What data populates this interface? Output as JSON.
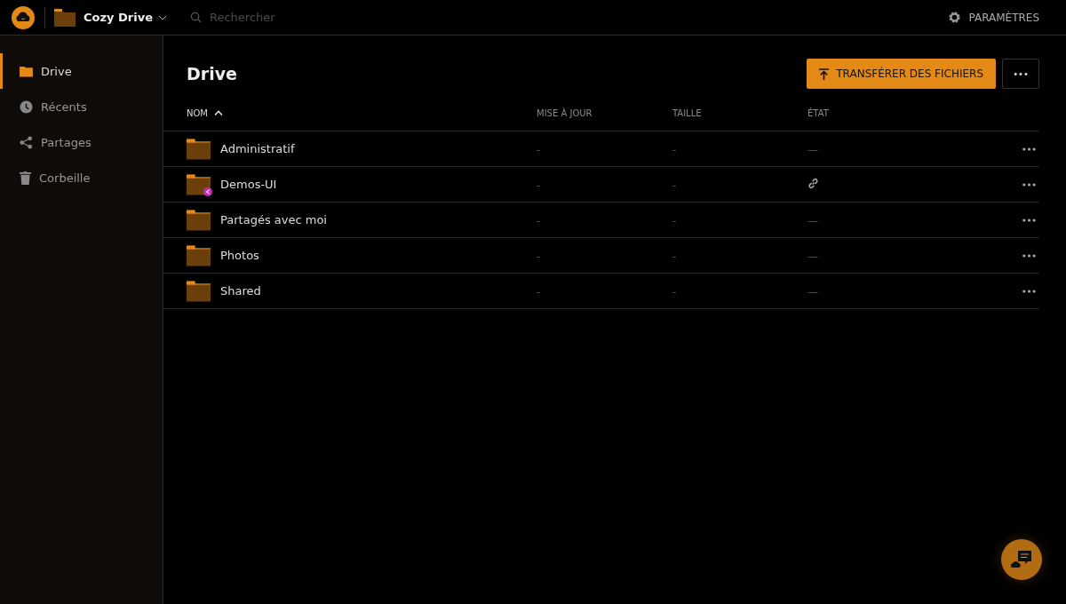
{
  "app": {
    "name": "Cozy Drive"
  },
  "search": {
    "placeholder": "Rechercher"
  },
  "settings": {
    "label": "PARAMÈTRES"
  },
  "sidebar": {
    "items": [
      {
        "label": "Drive",
        "selected": true
      },
      {
        "label": "Récents",
        "selected": false
      },
      {
        "label": "Partages",
        "selected": false
      },
      {
        "label": "Corbeille",
        "selected": false
      }
    ]
  },
  "page": {
    "title": "Drive",
    "upload_button": "TRANSFÉRER DES FICHIERS",
    "more_button": "•••"
  },
  "table": {
    "columns": [
      {
        "label": "NOM",
        "sorted": true
      },
      {
        "label": "MISE À JOUR",
        "sorted": false
      },
      {
        "label": "TAILLE",
        "sorted": false
      },
      {
        "label": "ÉTAT",
        "sorted": false
      }
    ],
    "rows": [
      {
        "name": "Administratif",
        "shared": false,
        "updated": "-",
        "size": "-",
        "state": {
          "kind": "text",
          "text": "—"
        }
      },
      {
        "name": "Demos-UI",
        "shared": true,
        "updated": "-",
        "size": "-",
        "state": {
          "kind": "link"
        }
      },
      {
        "name": "Partagés avec moi",
        "shared": false,
        "updated": "-",
        "size": "-",
        "state": {
          "kind": "text",
          "text": "—"
        }
      },
      {
        "name": "Photos",
        "shared": false,
        "updated": "-",
        "size": "-",
        "state": {
          "kind": "text",
          "text": "—"
        }
      },
      {
        "name": "Shared",
        "shared": false,
        "updated": "-",
        "size": "-",
        "state": {
          "kind": "text",
          "text": "—"
        }
      }
    ]
  }
}
